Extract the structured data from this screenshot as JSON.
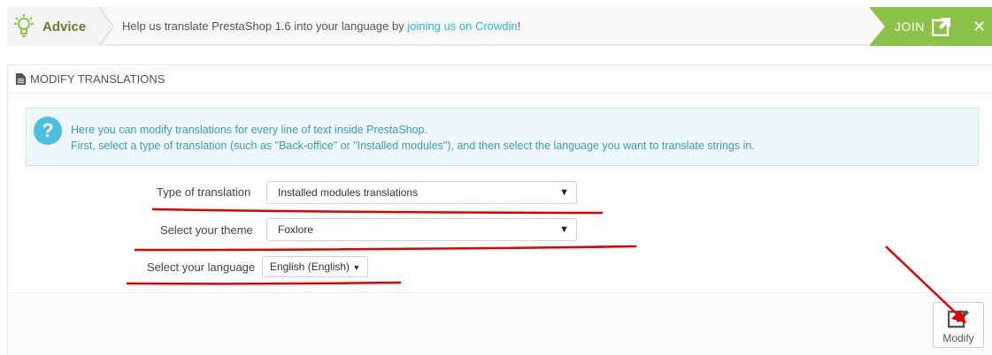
{
  "advice": {
    "label": "Advice",
    "message": "Help us translate PrestaShop 1.6 into your language by ",
    "link": "joining us on Crowdin",
    "message_end": "!",
    "join_label": "JOIN",
    "close": "✕"
  },
  "panel": {
    "title": "MODIFY TRANSLATIONS",
    "info_icon": "?",
    "info_line1": "Here you can modify translations for every line of text inside PrestaShop.",
    "info_line2": "First, select a type of translation (such as \"Back-office\" or \"Installed modules\"), and then select the language you want to translate strings in."
  },
  "form": {
    "type_label": "Type of translation",
    "type_value": "Installed modules translations",
    "theme_label": "Select your theme",
    "theme_value": "Foxlore",
    "language_label": "Select your language",
    "language_value": "English (English)"
  },
  "actions": {
    "modify_label": "Modify"
  },
  "icons": {
    "advice": "lightbulb-icon",
    "join": "external-link-icon",
    "close": "close-icon",
    "title": "file-icon",
    "info": "question-circle-icon",
    "caret": "caret-down-icon",
    "modify": "edit-icon"
  },
  "colors": {
    "accent": "#25b9d7",
    "join_bg": "#8bc34a",
    "advice_label": "#6b7d2a",
    "annotation": "#e00000"
  }
}
